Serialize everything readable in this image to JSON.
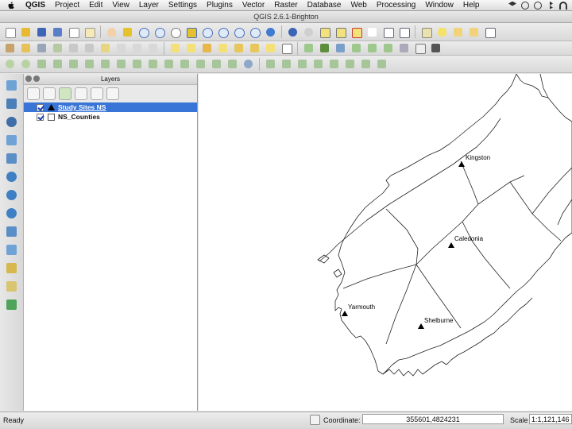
{
  "menubar": {
    "app_name": "QGIS",
    "items": [
      "Project",
      "Edit",
      "View",
      "Layer",
      "Settings",
      "Plugins",
      "Vector",
      "Raster",
      "Database",
      "Web",
      "Processing",
      "Window",
      "Help"
    ]
  },
  "window": {
    "title": "QGIS 2.6.1-Brighton"
  },
  "layers_panel": {
    "title": "Layers",
    "layers": [
      {
        "name": "Study Sites NS",
        "checked": true,
        "selected": true,
        "symbol": "triangle"
      },
      {
        "name": "NS_Counties",
        "checked": true,
        "selected": false,
        "symbol": "polygon"
      }
    ]
  },
  "map": {
    "sites": [
      {
        "name": "Kingston"
      },
      {
        "name": "Caledonia"
      },
      {
        "name": "Yarmouth"
      },
      {
        "name": "Shelburne"
      }
    ]
  },
  "status": {
    "ready": "Ready",
    "coordinate_label": "Coordinate:",
    "coordinate_value": "355601,4824231",
    "scale_label": "Scale",
    "scale_value": "1:1,121,146"
  },
  "colors": {
    "selection": "#3875d7",
    "accent_green": "#3f9b3f",
    "accent_yellow": "#e5c12e"
  }
}
